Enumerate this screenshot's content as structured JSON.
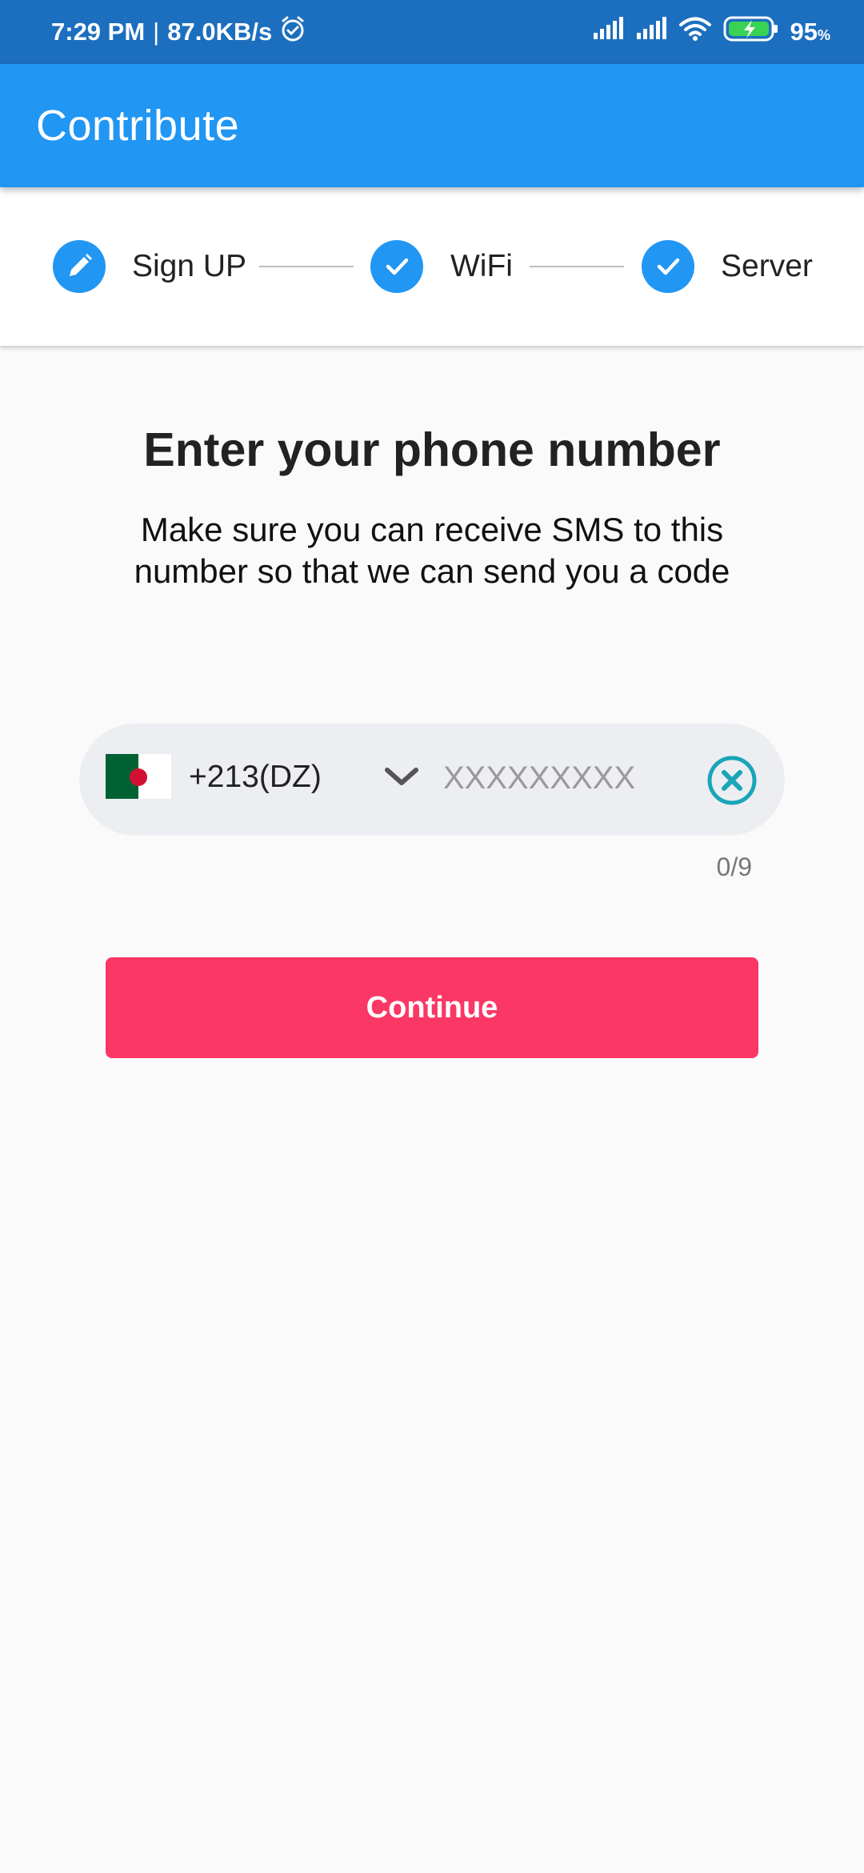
{
  "status_bar": {
    "time": "7:29 PM",
    "separator": "|",
    "network_speed": "87.0KB/s",
    "battery_level": "95",
    "battery_unit": "%",
    "icons": [
      "alarm-icon",
      "signal-icon",
      "signal-icon",
      "wifi-icon",
      "battery-charging-icon"
    ]
  },
  "app_bar": {
    "title": "Contribute"
  },
  "stepper": {
    "steps": [
      {
        "label": "Sign UP",
        "icon": "pencil-icon",
        "state": "editing"
      },
      {
        "label": "WiFi",
        "icon": "check-icon",
        "state": "complete"
      },
      {
        "label": "Server",
        "icon": "check-icon",
        "state": "complete"
      }
    ]
  },
  "main": {
    "title": "Enter your phone number",
    "subtitle": "Make sure you can receive SMS to this number so that we can send you a code"
  },
  "phone_field": {
    "country_flag": "algeria-flag-icon",
    "country_code": "+213(DZ)",
    "value": "",
    "placeholder": "XXXXXXXXX",
    "counter": "0/9"
  },
  "continue_button": {
    "label": "Continue"
  },
  "colors": {
    "status_bar": "#1c6fbf",
    "primary": "#2196f3",
    "accent": "#fb3766",
    "clear_icon": "#1aa5b8",
    "background": "#fafafa"
  }
}
